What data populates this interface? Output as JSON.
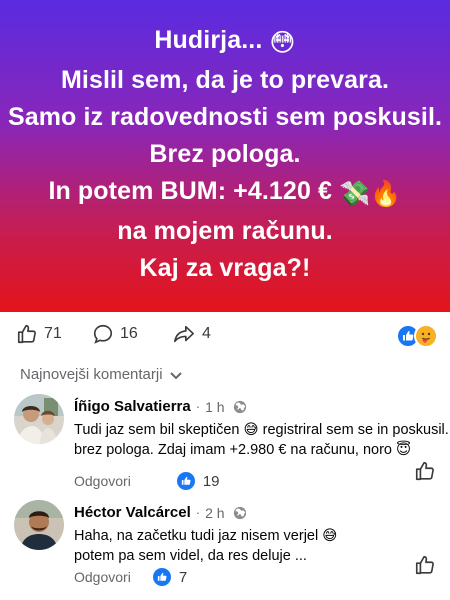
{
  "hero": {
    "lines": [
      {
        "text": "Hudirja...",
        "emoji": "😳"
      },
      {
        "text": "Mislil sem, da je to prevara.",
        "emoji": ""
      },
      {
        "text": "Samo iz radovednosti sem poskusil.",
        "emoji": ""
      },
      {
        "text": "Brez pologa.",
        "emoji": ""
      },
      {
        "text": "In potem BUM: +4.120 €",
        "emoji": "💸🔥"
      },
      {
        "text": "na mojem računu.",
        "emoji": ""
      },
      {
        "text": "Kaj za vraga?!",
        "emoji": ""
      }
    ],
    "colors": {
      "top": "#5a2be0",
      "bottom": "#e3141a"
    }
  },
  "reactions": {
    "like_count": "71",
    "comment_count": "16",
    "share_count": "4"
  },
  "sort": {
    "label": "Najnovejši komentarji"
  },
  "comments": [
    {
      "name": "Íñigo Salvatierra",
      "time": "1 h",
      "line1": "Tudi jaz sem bil skeptičen 😅 registriral sem se in poskusil...",
      "line2": "brez pologa. Zdaj imam +2.980 € na računu, noro 😇",
      "reply": "Odgovori",
      "likes": "19"
    },
    {
      "name": "Héctor Valcárcel",
      "time": "2 h",
      "line1": "Haha, na začetku tudi jaz nisem verjel 😅",
      "line2": "potem pa sem videl, da res deluje ...",
      "reply": "Odgovori",
      "likes": "7"
    }
  ]
}
